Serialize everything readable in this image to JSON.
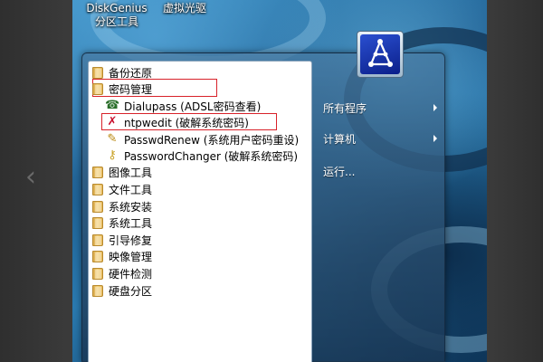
{
  "desktop": {
    "icons": [
      {
        "label_line1": "DiskGenius",
        "label_line2": "分区工具"
      },
      {
        "label_line1": "虚拟光驱",
        "label_line2": ""
      }
    ]
  },
  "programs": {
    "items": [
      {
        "label": "备份还原",
        "type": "folder"
      },
      {
        "label": "密码管理",
        "type": "folder"
      },
      {
        "label": "Dialupass (ADSL密码查看)",
        "type": "app",
        "icon": "dialupass-icon"
      },
      {
        "label": "ntpwedit (破解系统密码)",
        "type": "app",
        "icon": "ntpwedit-icon"
      },
      {
        "label": "PasswdRenew (系统用户密码重设)",
        "type": "app",
        "icon": "passwdrenew-icon"
      },
      {
        "label": "PasswordChanger (破解系统密码)",
        "type": "app",
        "icon": "passwordchanger-icon"
      },
      {
        "label": "图像工具",
        "type": "folder"
      },
      {
        "label": "文件工具",
        "type": "folder"
      },
      {
        "label": "系统安装",
        "type": "folder"
      },
      {
        "label": "系统工具",
        "type": "folder"
      },
      {
        "label": "引导修复",
        "type": "folder"
      },
      {
        "label": "映像管理",
        "type": "folder"
      },
      {
        "label": "硬件检测",
        "type": "folder"
      },
      {
        "label": "硬盘分区",
        "type": "folder"
      }
    ]
  },
  "right_pane": {
    "all_programs": "所有程序",
    "computer": "计算机",
    "run": "运行..."
  },
  "colors": {
    "highlight_border": "#d8222a",
    "menu_text": "#000000",
    "right_text": "#ffffff"
  }
}
